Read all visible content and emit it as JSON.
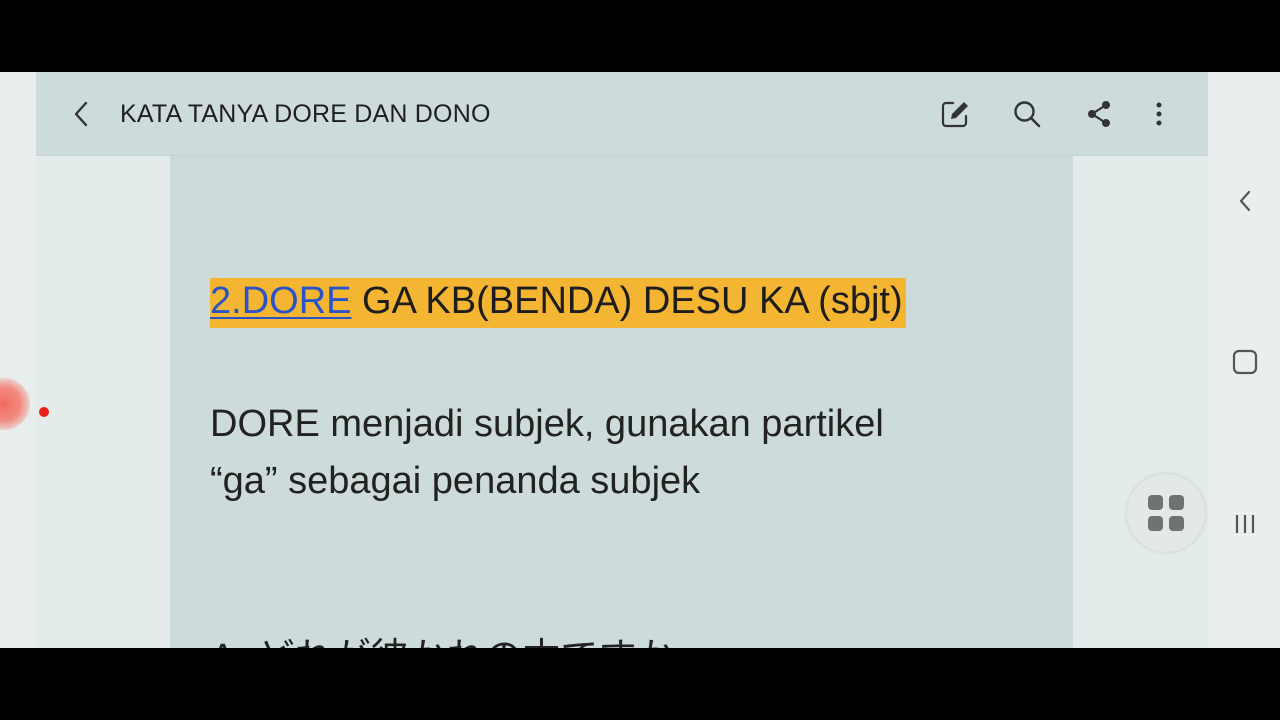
{
  "toolbar": {
    "title": "KATA TANYA DORE DAN DONO",
    "icons": [
      "back-arrow-icon",
      "edit-icon",
      "search-icon",
      "share-icon",
      "more-vertical-icon"
    ]
  },
  "content": {
    "heading_link": "2.DORE",
    "heading_rest": " GA KB(BENDA) DESU KA (sbjt)",
    "paragraph_line1": "DORE menjadi subjek, gunakan partikel",
    "paragraph_line2": "“ga” sebagai penanda subjek",
    "partial_line": "A: どれが彼かれの本ですか"
  },
  "colors": {
    "highlight": "#f4b533",
    "link": "#2854c8",
    "toolbar_bg": "#cddcdb",
    "page_bg": "#cddcdb",
    "record_dot": "#e8211a"
  },
  "system_nav": {
    "icons": [
      "chevron-left-icon",
      "home-square-icon",
      "recents-icon",
      "apps-grid-icon"
    ]
  }
}
